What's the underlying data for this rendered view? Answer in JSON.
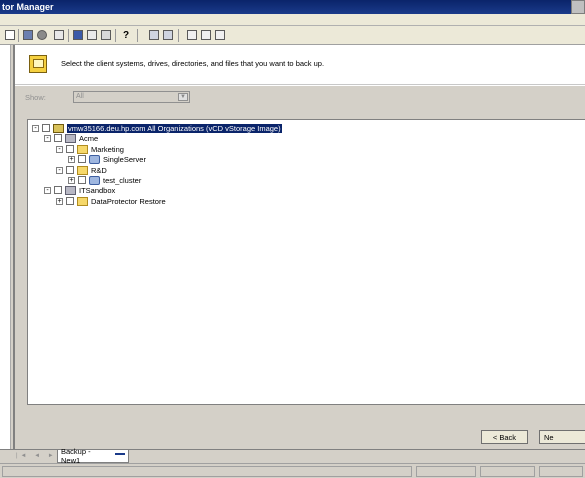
{
  "window": {
    "title": "tor Manager"
  },
  "toolbar": {
    "buttons": [
      "save-icon",
      "stop-icon",
      "list-icon",
      "pin-icon",
      "window-icon",
      "window2-icon",
      "help-icon",
      "tree-expand-icon",
      "tree-collapse-icon",
      "hand-icon",
      "edit-icon",
      "link-icon"
    ],
    "help_glyph": "?"
  },
  "wizard": {
    "instruction": "Select the client systems, drives, directories, and files that you want to back up.",
    "show_label": "Show:",
    "show_value": "All"
  },
  "tree": {
    "root": "vmw35166.deu.hp.com All Organizations (vCD vStorage Image)",
    "acme": "Acme",
    "marketing": "Marketing",
    "singleserver": "SingleServer",
    "rd": "R&D",
    "test_cluster": "test_cluster",
    "itsandbox": "ITSandbox",
    "dp_restore": "DataProtector Restore"
  },
  "buttons": {
    "back": "< Back",
    "next": "Ne"
  },
  "tabs": {
    "active": "Backup - New1"
  },
  "glyphs": {
    "expand": "+",
    "collapse": "-",
    "nav": "|◄ ◄ ► ►|"
  }
}
